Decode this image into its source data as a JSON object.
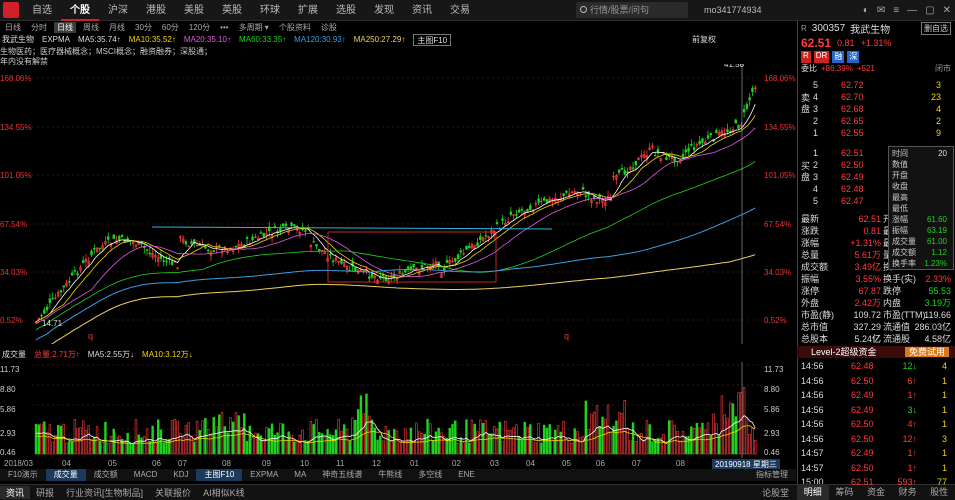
{
  "nav": {
    "items": [
      "自选",
      "个股",
      "沪深",
      "港股",
      "美股",
      "英股",
      "环球",
      "扩展",
      "选股",
      "发现",
      "资讯",
      "交易"
    ],
    "active": 1,
    "search_placeholder": "行情/股票/问句",
    "user": "mo341774934"
  },
  "toolbar": [
    "日线",
    "分时",
    "日线",
    "周线",
    "月线",
    "30分",
    "60分",
    "120分",
    "•••",
    "多周期 ▾",
    "个股资料",
    "诊股"
  ],
  "info": {
    "stock": "我武生物",
    "ind": "EXPMA",
    "ma5": "MA5:35.74↑",
    "ma10": "MA10:35.52↑",
    "ma20": "MA20:35.10↑",
    "ma60": "MA60:33.35↑",
    "ma120": "MA120:30.93↑",
    "ma250": "MA250:27.29↑",
    "btn": "主图F10",
    "right": "前复权"
  },
  "concept": "生物医药；医疗器械概念；MSCI概念；融资融券；深股通；",
  "note": "年内没有解禁",
  "price_axis": [
    "168.06%",
    "134.55%",
    "101.05%",
    "67.54%",
    "34.03%",
    "0.52%"
  ],
  "hi_label": "41.58",
  "lo_label": "14.71",
  "vol": {
    "title": "成交量",
    "total": "总量:2.71万↑",
    "ma5": "MA5:2.55万↓",
    "ma10": "MA10:3.12万↓",
    "axis": [
      "11.73",
      "8.80",
      "5.86",
      "2.93"
    ],
    "min": "0.46"
  },
  "xaxis": [
    "2018/03",
    "04",
    "05",
    "06",
    "07",
    "08",
    "09",
    "10",
    "11",
    "12",
    "01",
    "02",
    "03",
    "04",
    "05",
    "06",
    "07",
    "08",
    "20190918 星期三"
  ],
  "bottom_tabs": [
    "F10演示",
    "成交量",
    "成交额",
    "MACD",
    "KDJ",
    "主图F10",
    "EXPMA",
    "MA",
    "神奇五线谱",
    "牛熊线",
    "多空线",
    "ENE",
    "指标管理"
  ],
  "status": [
    "资讯",
    "研报",
    "行业资讯[生物制品]",
    "关联报价",
    "AI相似K线"
  ],
  "status_right": "论股堂",
  "right": {
    "code": "300357",
    "name": "我武生物",
    "add": "删自选",
    "price": "62.51",
    "chg": "0.81",
    "pct": "+1.31%",
    "wb": "+86.39%",
    "wc": "+521",
    "wb_label": "委比",
    "mode": "闭市",
    "asks": [
      [
        "5",
        "62.72",
        "3"
      ],
      [
        "4",
        "62.70",
        "23"
      ],
      [
        "3",
        "62.68",
        "4"
      ],
      [
        "2",
        "62.65",
        "2"
      ],
      [
        "1",
        "62.55",
        "9"
      ]
    ],
    "bids": [
      [
        "1",
        "62.51",
        ""
      ],
      [
        "2",
        "62.50",
        ""
      ],
      [
        "3",
        "62.49",
        ""
      ],
      [
        "4",
        "62.48",
        ""
      ],
      [
        "5",
        "62.47",
        ""
      ]
    ],
    "sell_label": "卖盘",
    "buy_label": "买盘",
    "stats": [
      [
        "最新",
        "62.51",
        "开",
        ""
      ],
      [
        "涨跌",
        "0.81",
        "最高",
        ""
      ],
      [
        "涨幅",
        "+1.31%",
        "最低",
        ""
      ],
      [
        "总量",
        "5.61万",
        "量比",
        ""
      ],
      [
        "成交额",
        "3.49亿",
        "换",
        ""
      ],
      [
        "振幅",
        "3.55%",
        "换手(实)",
        "2.33%"
      ],
      [
        "涨停",
        "67.87",
        "跌停",
        "55.53"
      ],
      [
        "外盘",
        "2.42万",
        "内盘",
        "3.19万"
      ],
      [
        "市盈(静)",
        "109.72",
        "市盈(TTM)",
        "119.66"
      ],
      [
        "总市值",
        "327.29亿",
        "流通值",
        "286.03亿"
      ],
      [
        "总股本",
        "5.24亿",
        "流通股",
        "4.58亿"
      ]
    ],
    "popup": [
      [
        "时间",
        "20"
      ],
      [
        "数值",
        ""
      ],
      [
        "开盘",
        ""
      ],
      [
        "收盘",
        ""
      ],
      [
        "最高",
        ""
      ],
      [
        "最低",
        ""
      ],
      [
        "涨幅",
        "61.60"
      ],
      [
        "振幅",
        "63.19"
      ],
      [
        "成交量",
        "61.00"
      ],
      [
        "成交额",
        "1.12"
      ],
      [
        "换手率",
        "1.23%"
      ]
    ],
    "level2": "Level-2超级资金",
    "trial": "免费试用",
    "ticks": [
      [
        "14:56",
        "62.48",
        "12",
        "4"
      ],
      [
        "14:56",
        "62.50",
        "6",
        "1"
      ],
      [
        "14:56",
        "62.49",
        "1",
        "1"
      ],
      [
        "14:56",
        "62.49",
        "3",
        "1"
      ],
      [
        "14:56",
        "62.50",
        "4",
        "1"
      ],
      [
        "14:56",
        "62.50",
        "12",
        "3"
      ],
      [
        "14:57",
        "62.49",
        "1",
        "1"
      ],
      [
        "14:57",
        "62.50",
        "1",
        "1"
      ],
      [
        "15:00",
        "62.51",
        "593",
        "77"
      ]
    ],
    "tabs": [
      "明细",
      "筹码",
      "资金",
      "财务",
      "股性"
    ]
  }
}
